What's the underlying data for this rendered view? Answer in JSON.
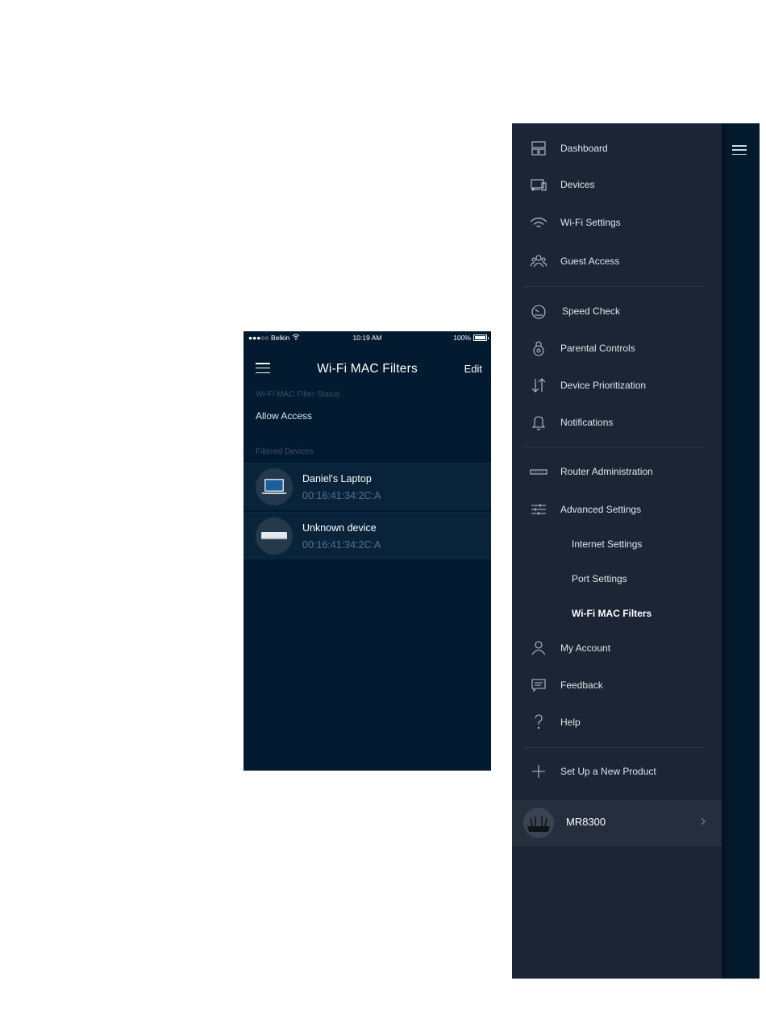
{
  "phone": {
    "status_bar": {
      "carrier": "●●●○○ Belkin",
      "time": "10:19 AM",
      "battery": "100%"
    },
    "nav": {
      "title": "Wi-Fi MAC Filters",
      "edit_label": "Edit"
    },
    "filter_status": {
      "label": "Wi-Fi MAC Filter Status",
      "value": "Allow Access"
    },
    "filtered_devices": {
      "label": "Filtered Devices",
      "items": [
        {
          "name": "Daniel's Laptop",
          "mac": "00:16:41:34:2C:A",
          "icon": "laptop-icon"
        },
        {
          "name": "Unknown device",
          "mac": "00:16:41:34:2C:A",
          "icon": "generic-device-icon"
        }
      ]
    }
  },
  "drawer": {
    "items": [
      {
        "label": "Dashboard",
        "icon": "dashboard-icon"
      },
      {
        "label": "Devices",
        "icon": "devices-icon"
      },
      {
        "label": "Wi-Fi Settings",
        "icon": "wifi-icon"
      },
      {
        "label": "Guest Access",
        "icon": "guest-access-icon"
      },
      {
        "label": "Speed Check",
        "icon": "speedometer-icon"
      },
      {
        "label": "Parental Controls",
        "icon": "lock-icon"
      },
      {
        "label": "Device Prioritization",
        "icon": "up-down-arrows-icon"
      },
      {
        "label": "Notifications",
        "icon": "bell-icon"
      },
      {
        "label": "Router Administration",
        "icon": "router-icon"
      },
      {
        "label": "Advanced Settings",
        "icon": "sliders-icon"
      },
      {
        "label": "My Account",
        "icon": "user-icon"
      },
      {
        "label": "Feedback",
        "icon": "chat-icon"
      },
      {
        "label": "Help",
        "icon": "question-icon"
      },
      {
        "label": "Set Up a New Product",
        "icon": "plus-icon"
      }
    ],
    "advanced_sub_items": [
      {
        "label": "Internet Settings",
        "active": false
      },
      {
        "label": "Port Settings",
        "active": false
      },
      {
        "label": "Wi-Fi MAC Filters",
        "active": true
      }
    ],
    "product": {
      "name": "MR8300"
    }
  }
}
